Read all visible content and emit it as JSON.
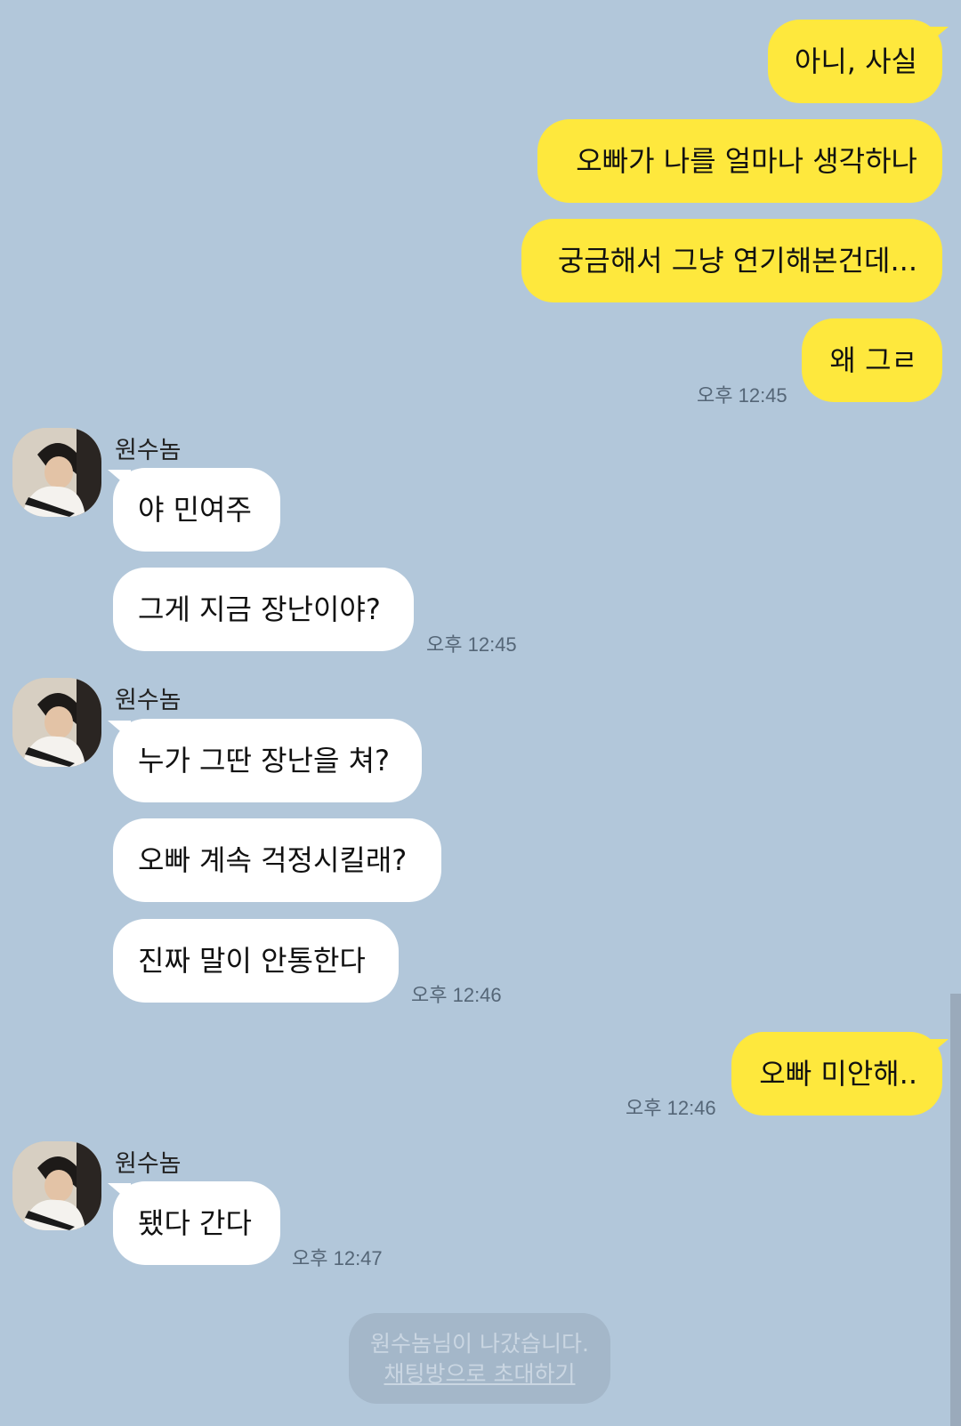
{
  "colors": {
    "background": "#b2c7da",
    "my_bubble": "#fee83d",
    "their_bubble": "#ffffff"
  },
  "sender": {
    "name": "원수놈",
    "avatar_icon": "profile-photo-person-with-guitar"
  },
  "messages": {
    "m1": "아니, 사실",
    "m2": "오빠가 나를 얼마나 생각하나",
    "m3": "궁금해서 그냥 연기해본건데...",
    "m4": "왜 그ㄹ",
    "m4_time": "오후 12:45",
    "g1_name": "원수놈",
    "g1_m1": "야 민여주",
    "g1_m2": "그게 지금 장난이야?",
    "g1_time": "오후 12:45",
    "g2_name": "원수놈",
    "g2_m1": "누가 그딴 장난을 쳐?",
    "g2_m2": "오빠 계속 걱정시킬래?",
    "g2_m3": "진짜 말이 안통한다",
    "g2_time": "오후 12:46",
    "m5": "오빠 미안해..",
    "m5_time": "오후 12:46",
    "g3_name": "원수놈",
    "g3_m1": "됐다 간다",
    "g3_time": "오후 12:47"
  },
  "notice": {
    "left_text": "원수놈님이 나갔습니다.",
    "invite_link": "채팅방으로 초대하기"
  }
}
